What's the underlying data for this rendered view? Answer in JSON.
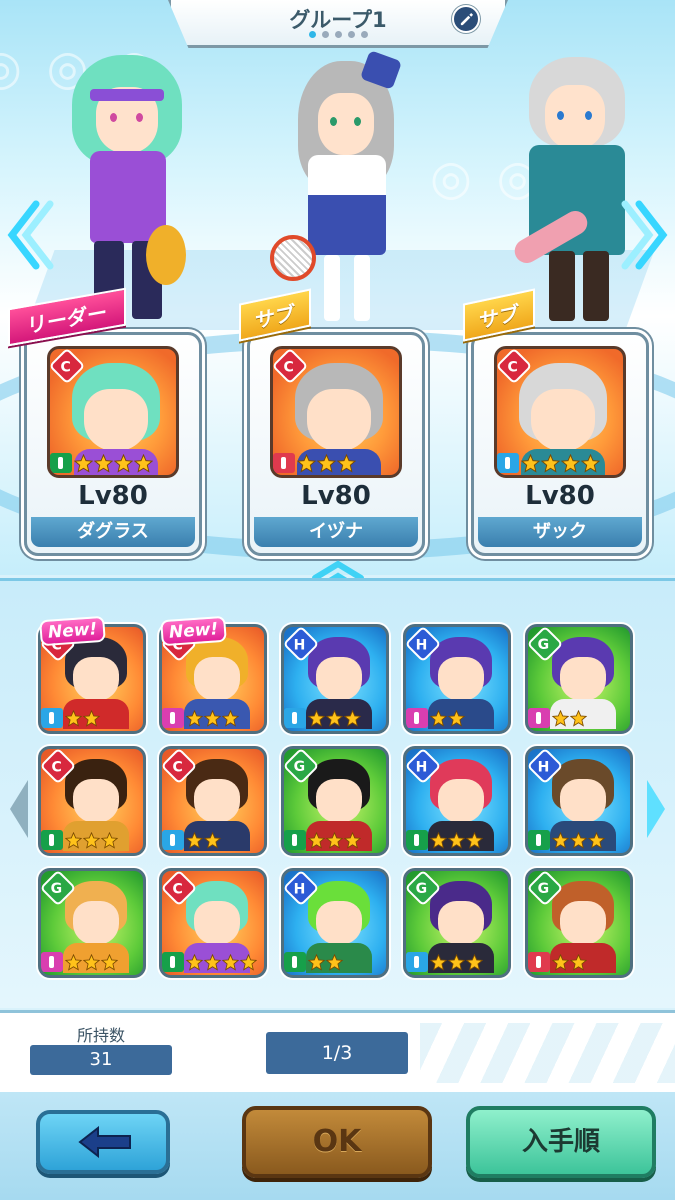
{
  "header": {
    "title": "グループ1",
    "page_count": 5,
    "active_page": 1
  },
  "team": [
    {
      "role": "リーダー",
      "rank": "C",
      "type_color": "#16a04a",
      "stars": 4,
      "level": "Lv80",
      "name": "ダグラス",
      "hair": "#6fe0c0",
      "outfit": "#9a4fd6"
    },
    {
      "role": "サブ",
      "rank": "C",
      "type_color": "#e03a4e",
      "stars": 3,
      "level": "Lv80",
      "name": "イヅナ",
      "hair": "#b8b8b8",
      "outfit": "#3a4fb0"
    },
    {
      "role": "サブ",
      "rank": "C",
      "type_color": "#2aa6e6",
      "stars": 4,
      "level": "Lv80",
      "name": "ザック",
      "hair": "#d8d8d8",
      "outfit": "#2a8a96"
    }
  ],
  "roster": [
    {
      "rank": "C",
      "new": "New!",
      "type": "blue",
      "stars": 2,
      "hair": "#2a2a3a",
      "outfit": "#d02a2a"
    },
    {
      "rank": "C",
      "new": "New!",
      "type": "pink",
      "stars": 3,
      "hair": "#f0b02a",
      "outfit": "#3a58b0"
    },
    {
      "rank": "H",
      "new": "",
      "type": "blue",
      "stars": 3,
      "hair": "#5a3ab0",
      "outfit": "#2a2a4a"
    },
    {
      "rank": "H",
      "new": "",
      "type": "pink",
      "stars": 2,
      "hair": "#5a3ab0",
      "outfit": "#2a4a8a"
    },
    {
      "rank": "G",
      "new": "",
      "type": "pink",
      "stars": 2,
      "hair": "#5a3ab0",
      "outfit": "#f0f0f0"
    },
    {
      "rank": "C",
      "new": "",
      "type": "green",
      "stars": 3,
      "hair": "#3a2210",
      "outfit": "#e0a030"
    },
    {
      "rank": "C",
      "new": "",
      "type": "blue",
      "stars": 2,
      "hair": "#4a2a14",
      "outfit": "#2a3a6a"
    },
    {
      "rank": "G",
      "new": "",
      "type": "green",
      "stars": 3,
      "hair": "#1a1a1a",
      "outfit": "#c02a2a"
    },
    {
      "rank": "H",
      "new": "",
      "type": "green",
      "stars": 3,
      "hair": "#e03a5a",
      "outfit": "#2a2a3a"
    },
    {
      "rank": "H",
      "new": "",
      "type": "green",
      "stars": 3,
      "hair": "#6a4a2a",
      "outfit": "#2a4a7a"
    },
    {
      "rank": "G",
      "new": "",
      "type": "pink",
      "stars": 3,
      "hair": "#f0b050",
      "outfit": "#f0a030"
    },
    {
      "rank": "C",
      "new": "",
      "type": "green",
      "stars": 4,
      "hair": "#6fe0c0",
      "outfit": "#9a4fd6"
    },
    {
      "rank": "H",
      "new": "",
      "type": "green",
      "stars": 2,
      "hair": "#6adf3a",
      "outfit": "#2a8a4a"
    },
    {
      "rank": "G",
      "new": "",
      "type": "blue",
      "stars": 3,
      "hair": "#4a2a8a",
      "outfit": "#2a2a3a"
    },
    {
      "rank": "G",
      "new": "",
      "type": "red",
      "stars": 2,
      "hair": "#c0602a",
      "outfit": "#c02a2a"
    }
  ],
  "info": {
    "count_label": "所持数",
    "count_value": "31",
    "page_indicator": "1/3"
  },
  "footer": {
    "back_icon": "arrow-left-icon",
    "ok_label": "OK",
    "sort_label": "入手順"
  },
  "colors": {
    "star": "#ffc21a",
    "star_empty": "#9fb8cc",
    "panel_blue": "#3c6a9a"
  }
}
